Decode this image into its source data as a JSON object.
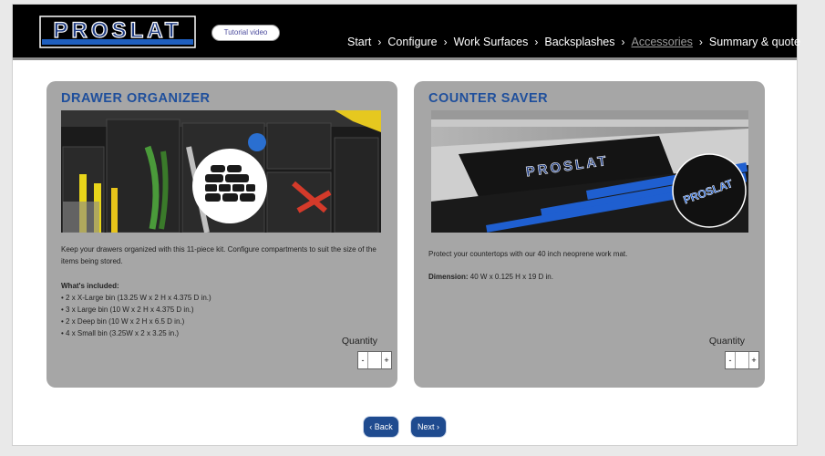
{
  "header": {
    "logo_text": "PROSLAT",
    "tutorial_label": "Tutorial video",
    "nav": [
      {
        "label": "Start",
        "active": false
      },
      {
        "label": "Configure",
        "active": false
      },
      {
        "label": "Work Surfaces",
        "active": false
      },
      {
        "label": "Backsplashes",
        "active": false
      },
      {
        "label": "Accessories",
        "active": true
      },
      {
        "label": "Summary & quote",
        "active": false
      }
    ],
    "separator": "›"
  },
  "products": [
    {
      "title": "DRAWER ORGANIZER",
      "description": "Keep your drawers organized with this 11-piece kit. Configure compartments to suit the size of the items being stored.",
      "included_heading": "What's included:",
      "included": [
        "• 2 x X-Large bin (13.25 W x 2 H x 4.375 D in.)",
        "• 3 x Large bin (10 W x 2 H x 4.375 D in.)",
        "• 2 x Deep bin (10 W x 2 H x 6.5 D in.)",
        "• 4 x Small bin (3.25W x 2 x 3.25 in.)"
      ],
      "quantity_label": "Quantity",
      "quantity_value": ""
    },
    {
      "title": "COUNTER SAVER",
      "description": "Protect your countertops with our 40 inch neoprene work mat.",
      "dimension_label": "Dimension:",
      "dimension_value": "40 W x 0.125 H x 19 D in.",
      "quantity_label": "Quantity",
      "quantity_value": ""
    }
  ],
  "stepper": {
    "minus": "-",
    "plus": "+"
  },
  "footer": {
    "back_label": "‹ Back",
    "next_label": "Next ›"
  },
  "colors": {
    "accent": "#1f4f9c",
    "header_bg": "#000000",
    "card_bg": "#a6a6a6",
    "button": "#1f4b8f"
  }
}
